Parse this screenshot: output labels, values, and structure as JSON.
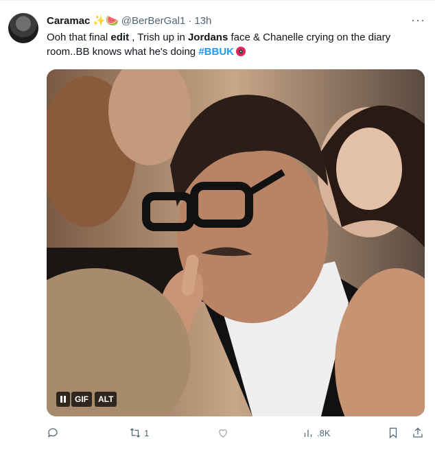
{
  "tweet": {
    "author_name": "Caramac",
    "author_emoji": "✨🍉",
    "handle": "@BerBerGal1",
    "separator": "·",
    "time": "13h",
    "more": "···",
    "text": {
      "p1": "Ooh that final ",
      "b1": "edit",
      "p2": " , Trish up in ",
      "b2": "Jordans",
      "p3": " face & Chanelle crying on the diary room..BB knows what he's doing ",
      "hashtag": "#BBUK"
    },
    "media": {
      "type": "gif",
      "badges": {
        "gif": "GIF",
        "alt": "ALT"
      }
    },
    "actions": {
      "reply_count": "",
      "retweet_count": "1",
      "like_count": "",
      "views_count": ".8K"
    }
  },
  "colors": {
    "accent": "#1d9bf0",
    "text": "#0f1419",
    "muted": "#536471",
    "eye_emoji": "#e0245e"
  }
}
